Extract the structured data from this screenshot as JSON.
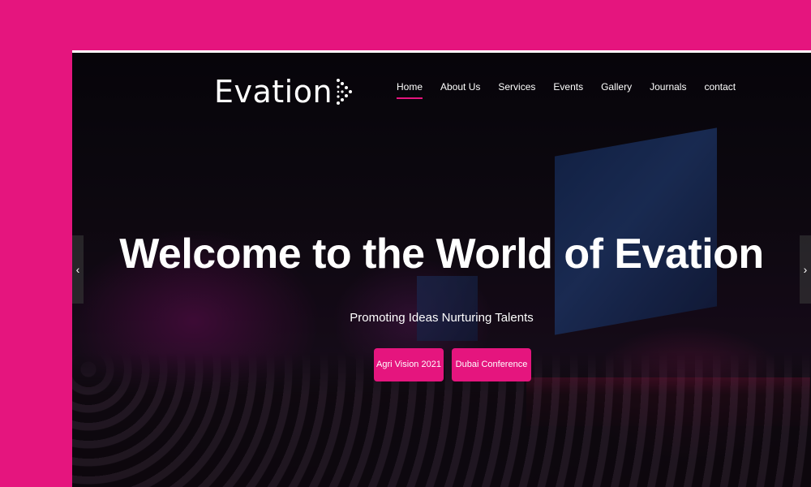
{
  "brand": {
    "logo_text": "Evation",
    "icon": "chevron-dots-icon",
    "accent_color": "#e5157e"
  },
  "nav": {
    "items": [
      {
        "label": "Home",
        "active": true
      },
      {
        "label": "About Us"
      },
      {
        "label": "Services"
      },
      {
        "label": "Events"
      },
      {
        "label": "Gallery"
      },
      {
        "label": "Journals"
      },
      {
        "label": "contact"
      }
    ]
  },
  "hero": {
    "title": "Welcome to the World of Evation",
    "subtitle": "Promoting Ideas Nurturing Talents",
    "buttons": [
      {
        "label": "Agri Vision 2021"
      },
      {
        "label": "Dubai Conference"
      }
    ]
  },
  "slider": {
    "prev_icon": "chevron-left-icon",
    "next_icon": "chevron-right-icon",
    "prev_glyph": "‹",
    "next_glyph": "›"
  }
}
